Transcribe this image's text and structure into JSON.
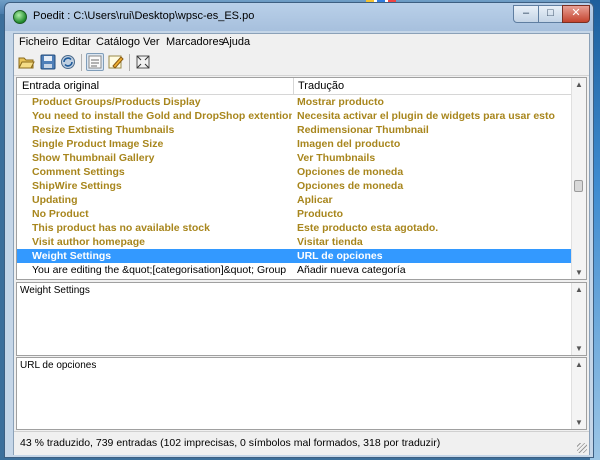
{
  "window": {
    "title": "Poedit : C:\\Users\\rui\\Desktop\\wpsc-es_ES.po",
    "minimize_label": "–",
    "maximize_label": "□",
    "close_label": "✕"
  },
  "menu": {
    "items": [
      "Ficheiro",
      "Editar",
      "Catálogo",
      "Ver",
      "Marcadores",
      "Ajuda"
    ]
  },
  "toolbar": {
    "icons": [
      "open-icon",
      "save-icon",
      "update-icon",
      "validate-icon",
      "edit-comment-icon",
      "fullscreen-icon"
    ]
  },
  "list": {
    "header": {
      "source": "Entrada original",
      "translation": "Tradução"
    },
    "rows": [
      {
        "source": "Product Groups/Products Display",
        "translation": "Mostrar producto",
        "state": "fuzzy"
      },
      {
        "source": "You need to install the Gold and DropShop extentions to use t...",
        "translation": "Necesita activar el plugin de widgets para usar esto",
        "state": "fuzzy"
      },
      {
        "source": "Resize Extisting Thumbnails",
        "translation": "Redimensionar Thumbnail",
        "state": "fuzzy"
      },
      {
        "source": "Single Product Image Size",
        "translation": "Imagen del producto",
        "state": "fuzzy"
      },
      {
        "source": "Show Thumbnail Gallery",
        "translation": "Ver Thumbnails",
        "state": "fuzzy"
      },
      {
        "source": "Comment Settings",
        "translation": "Opciones de moneda",
        "state": "fuzzy"
      },
      {
        "source": "ShipWire Settings",
        "translation": "Opciones de moneda",
        "state": "fuzzy"
      },
      {
        "source": "Updating",
        "translation": "Aplicar",
        "state": "fuzzy"
      },
      {
        "source": "No Product",
        "translation": "Producto",
        "state": "fuzzy"
      },
      {
        "source": "This product has no available stock",
        "translation": "Este producto esta agotado.",
        "state": "fuzzy"
      },
      {
        "source": "Visit author homepage",
        "translation": "Visitar tienda",
        "state": "fuzzy"
      },
      {
        "source": "Weight Settings",
        "translation": "URL de opciones",
        "state": "selected"
      },
      {
        "source": "You are editing the &quot;[categorisation]&quot; Group",
        "translation": "Añadir nueva categoría",
        "state": "plain"
      }
    ]
  },
  "source_text": "Weight Settings",
  "translation_text": "URL de opciones",
  "status": "43 % traduzido, 739 entradas (102 imprecisas, 0 símbolos mal formados, 318 por traduzir)",
  "colors": {
    "fuzzy": "#a8861d",
    "selected": "#3399ff"
  }
}
